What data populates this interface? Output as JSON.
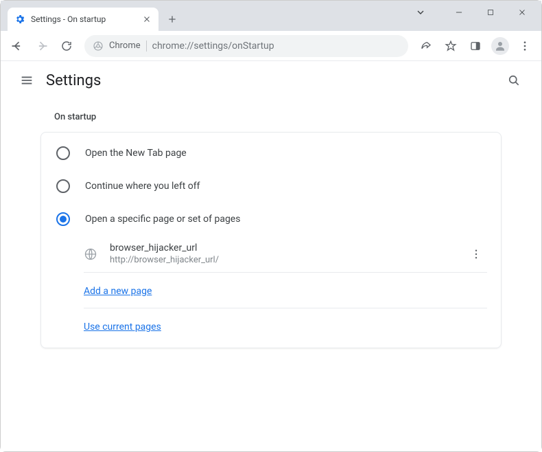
{
  "tab": {
    "title": "Settings - On startup"
  },
  "omnibox": {
    "chip": "Chrome",
    "url": "chrome://settings/onStartup"
  },
  "header": {
    "title": "Settings"
  },
  "section": {
    "title": "On startup",
    "options": [
      {
        "label": "Open the New Tab page"
      },
      {
        "label": "Continue where you left off"
      },
      {
        "label": "Open a specific page or set of pages"
      }
    ],
    "pages": [
      {
        "name": "browser_hijacker_url",
        "url": "http://browser_hijacker_url/"
      }
    ],
    "add_link": "Add a new page",
    "use_link": "Use current pages"
  }
}
